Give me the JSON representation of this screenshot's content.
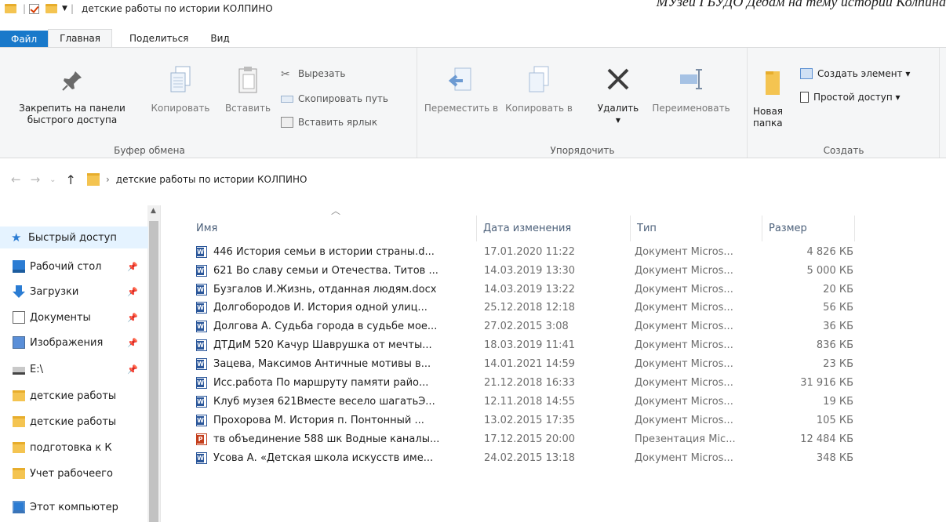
{
  "caption": "МУзей ГБУДО Дедам на тему истории Колпина",
  "window": {
    "title": "детские работы по истории КОЛПИНО"
  },
  "tabs": [
    {
      "label": "Файл"
    },
    {
      "label": "Главная"
    },
    {
      "label": "Поделиться"
    },
    {
      "label": "Вид"
    }
  ],
  "ribbon": {
    "clipboard": {
      "pin_label": "Закрепить на панели быстрого доступа",
      "copy_label": "Копировать",
      "paste_label": "Вставить",
      "cut_label": "Вырезать",
      "copy_path_label": "Скопировать путь",
      "paste_shortcut_label": "Вставить ярлык",
      "group_label": "Буфер обмена"
    },
    "organize": {
      "move_label": "Переместить в",
      "copy_to_label": "Копировать в",
      "delete_label": "Удалить",
      "rename_label": "Переименовать",
      "group_label": "Упорядочить"
    },
    "create": {
      "new_folder_label": "Новая папка",
      "new_item_label": "Создать элемент ▾",
      "easy_access_label": "Простой доступ ▾",
      "group_label": "Создать"
    }
  },
  "address": {
    "path": "детские работы по истории КОЛПИНО"
  },
  "nav": {
    "items": [
      {
        "label": "Быстрый доступ",
        "icon": "star-icon"
      },
      {
        "label": "Рабочий стол",
        "icon": "desktop-icon"
      },
      {
        "label": "Загрузки",
        "icon": "download-icon"
      },
      {
        "label": "Документы",
        "icon": "documents-icon"
      },
      {
        "label": "Изображения",
        "icon": "pictures-icon"
      },
      {
        "label": "E:\\",
        "icon": "drive-icon"
      },
      {
        "label": "детские работы",
        "icon": "folder-icon"
      },
      {
        "label": "детские работы",
        "icon": "folder-icon"
      },
      {
        "label": "подготовка к К",
        "icon": "folder-icon"
      },
      {
        "label": "Учет рабочеего",
        "icon": "folder-icon"
      },
      {
        "label": "Этот компьютер",
        "icon": "computer-icon"
      }
    ]
  },
  "columns": {
    "name": "Имя",
    "date": "Дата изменения",
    "type": "Тип",
    "size": "Размер"
  },
  "files": [
    {
      "name": "446 История семьи в истории страны.d...",
      "date": "17.01.2020 11:22",
      "type": "Документ Micros...",
      "size": "4 826 КБ",
      "kind": "word"
    },
    {
      "name": "621 Во славу семьи и Отечества. Титов ...",
      "date": "14.03.2019 13:30",
      "type": "Документ Micros...",
      "size": "5 000 КБ",
      "kind": "word"
    },
    {
      "name": "Бузгалов И.Жизнь, отданная людям.docx",
      "date": "14.03.2019 13:22",
      "type": "Документ Micros...",
      "size": "20 КБ",
      "kind": "word"
    },
    {
      "name": "Долгобородов И. История одной улиц...",
      "date": "25.12.2018 12:18",
      "type": "Документ Micros...",
      "size": "56 КБ",
      "kind": "word"
    },
    {
      "name": "Долгова А. Судьба города в судьбе мое...",
      "date": "27.02.2015 3:08",
      "type": "Документ Micros...",
      "size": "36 КБ",
      "kind": "word"
    },
    {
      "name": "ДТДиМ  520 Качур Шаврушка от мечты...",
      "date": "18.03.2019 11:41",
      "type": "Документ Micros...",
      "size": "836 КБ",
      "kind": "word"
    },
    {
      "name": "Зацева, Максимов Античные мотивы в...",
      "date": "14.01.2021 14:59",
      "type": "Документ Micros...",
      "size": "23 КБ",
      "kind": "word"
    },
    {
      "name": "Исс.работа По маршруту памяти райо...",
      "date": "21.12.2018 16:33",
      "type": "Документ Micros...",
      "size": "31 916 КБ",
      "kind": "word"
    },
    {
      "name": "Клуб музея 621Вместе весело шагатьЭ...",
      "date": "12.11.2018 14:55",
      "type": "Документ Micros...",
      "size": "19 КБ",
      "kind": "word"
    },
    {
      "name": "Прохорова М. История п. Понтонный ...",
      "date": "13.02.2015 17:35",
      "type": "Документ Micros...",
      "size": "105 КБ",
      "kind": "word"
    },
    {
      "name": "тв объединение 588 шк Водные каналы...",
      "date": "17.12.2015 20:00",
      "type": "Презентация Mic...",
      "size": "12 484 КБ",
      "kind": "ppt"
    },
    {
      "name": "Усова А. «Детская школа искусств име...",
      "date": "24.02.2015 13:18",
      "type": "Документ Micros...",
      "size": "348 КБ",
      "kind": "word"
    }
  ]
}
